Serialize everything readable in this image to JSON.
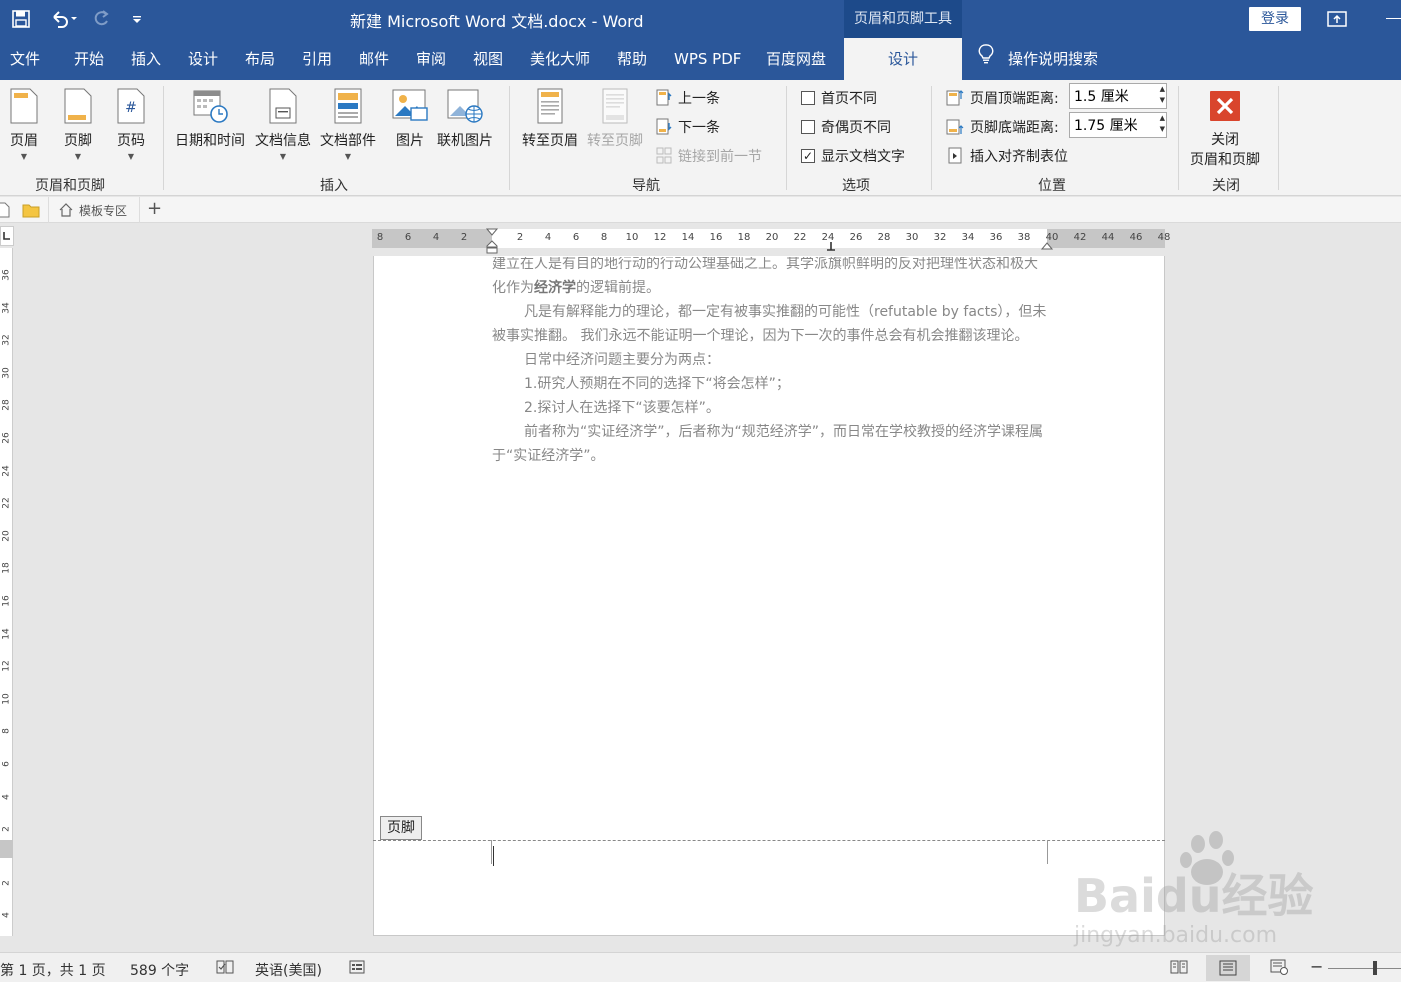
{
  "titlebar": {
    "title": "新建 Microsoft Word 文档.docx  -  Word",
    "contextual_title": "页眉和页脚工具",
    "login_label": "登录"
  },
  "tabs": {
    "file": "文件",
    "home": "开始",
    "insert": "插入",
    "design": "设计",
    "layout": "布局",
    "references": "引用",
    "mailings": "邮件",
    "review": "审阅",
    "view": "视图",
    "beautify": "美化大师",
    "help": "帮助",
    "wps_pdf": "WPS PDF",
    "baidu_pan": "百度网盘",
    "hf_design": "设计",
    "tell_me": "操作说明搜索"
  },
  "ribbon": {
    "header": "页眉",
    "footer": "页脚",
    "page_number": "页码",
    "group_header_footer": "页眉和页脚",
    "date_time": "日期和时间",
    "doc_info": "文档信息",
    "quick_parts": "文档部件",
    "picture": "图片",
    "online_picture": "联机图片",
    "group_insert": "插入",
    "goto_header": "转至页眉",
    "goto_footer": "转至页脚",
    "previous": "上一条",
    "next": "下一条",
    "link_previous": "链接到前一节",
    "group_navigation": "导航",
    "different_first": "首页不同",
    "different_odd_even": "奇偶页不同",
    "show_doc_text": "显示文档文字",
    "group_options": "选项",
    "header_from_top_label": "页眉顶端距离:",
    "header_from_top_value": "1.5 厘米",
    "footer_from_bottom_label": "页脚底端距离:",
    "footer_from_bottom_value": "1.75 厘米",
    "insert_align_tab": "插入对齐制表位",
    "group_position": "位置",
    "close_line1": "关闭",
    "close_line2": "页眉和页脚",
    "group_close": "关闭",
    "different_first_checked": false,
    "different_odd_even_checked": false,
    "show_doc_text_checked": true
  },
  "docstrip": {
    "template_tab": "模板专区"
  },
  "ruler": {
    "left_ticks": [
      "8",
      "6",
      "4",
      "2"
    ],
    "right_ticks": [
      "2",
      "4",
      "6",
      "8",
      "10",
      "12",
      "14",
      "16",
      "18",
      "20",
      "22",
      "24",
      "26",
      "28",
      "30",
      "32",
      "34",
      "36",
      "38",
      "40",
      "42",
      "44",
      "46",
      "48"
    ],
    "vertical_ticks": [
      "36",
      "34",
      "32",
      "30",
      "28",
      "26",
      "24",
      "22",
      "20",
      "18",
      "16",
      "14",
      "12",
      "10",
      "8",
      "6",
      "4",
      "2",
      "2",
      "4"
    ]
  },
  "document": {
    "line1": "建立在人是有目的地行动的行动公理基础之上。其学派旗帜鲜明的反对把理性状态和极大",
    "line2_a": "化作为",
    "line2_b": "经济学",
    "line2_c": "的逻辑前提。",
    "line3": "凡是有解释能力的理论，都一定有被事实推翻的可能性（refutable by facts），但未",
    "line4": "被事实推翻。 我们永远不能证明一个理论，因为下一次的事件总会有机会推翻该理论。",
    "line5": "日常中经济问题主要分为两点：",
    "line6": "1.研究人预期在不同的选择下“将会怎样”；",
    "line7": "2.探讨人在选择下“该要怎样”。",
    "line8": "前者称为“实证经济学”，后者称为“规范经济学”，而日常在学校教授的经济学课程属",
    "line9": "于“实证经济学”。",
    "footer_tag": "页脚"
  },
  "status": {
    "page": "第 1 页，共 1 页",
    "words": "589 个字",
    "language": "英语(美国)"
  },
  "watermark": {
    "brand": "Baidu经验",
    "url": "jingyan.baidu.com"
  },
  "colors": {
    "accent": "#2b579a",
    "close_red": "#d9452c"
  }
}
